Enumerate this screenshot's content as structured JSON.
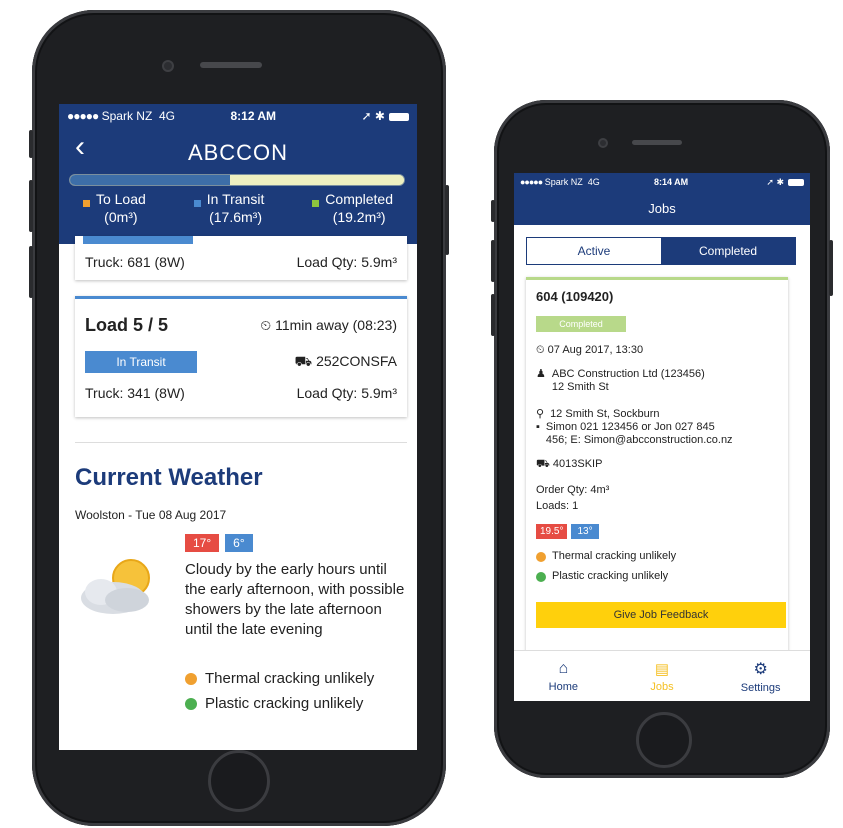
{
  "colors": {
    "brand_blue": "#1c3b7a",
    "to_load": "#f0a030",
    "in_transit": "#4a8ad0",
    "completed": "#8dc63f",
    "temp_high": "#e64c43",
    "temp_low": "#4a8ad0",
    "thermal": "#f0a030",
    "plastic": "#4caf50",
    "feedback": "#ffd00c",
    "jobs_active": "#f5c024"
  },
  "left_phone": {
    "status": {
      "carrier": "Spark NZ",
      "network": "4G",
      "time": "8:12 AM"
    },
    "header": {
      "back_icon": "chevron-left-icon",
      "title": "ABCCON"
    },
    "progress": {
      "to_load": 0,
      "in_transit": 17.6,
      "completed": 19.2
    },
    "legend": [
      {
        "label": "To Load",
        "amount": "(0m³)"
      },
      {
        "label": "In Transit",
        "amount": "(17.6m³)"
      },
      {
        "label": "Completed",
        "amount": "(19.2m³)"
      }
    ],
    "prev_card": {
      "truck": "Truck: 681 (8W)",
      "load_qty": "Load Qty: 5.9m³"
    },
    "load_card": {
      "title": "Load 5 / 5",
      "eta": "11min away (08:23)",
      "status": "In Transit",
      "plant": "252CONSFA",
      "truck": "Truck: 341 (8W)",
      "load_qty": "Load Qty: 5.9m³"
    },
    "weather": {
      "title": "Current Weather",
      "location_date": "Woolston - Tue 08 Aug 2017",
      "high": "17°",
      "low": "6°",
      "description": "Cloudy by the early hours until the early afternoon, with possible showers by the late afternoon until the late evening",
      "thermal": "Thermal cracking unlikely",
      "plastic": "Plastic cracking unlikely"
    }
  },
  "right_phone": {
    "status": {
      "carrier": "Spark NZ",
      "network": "4G",
      "time": "8:14 AM"
    },
    "header": {
      "title": "Jobs"
    },
    "segments": {
      "active": "Active",
      "completed": "Completed"
    },
    "job": {
      "title": "604 (109420)",
      "status": "Completed",
      "datetime": "07 Aug 2017, 13:30",
      "customer": "ABC Construction Ltd (123456)",
      "customer_address": "12 Smith St",
      "site_address": "12 Smith St, Sockburn",
      "contact_line1": "Simon 021 123456 or Jon 027 845",
      "contact_line2": "456; E: Simon@abcconstruction.co.nz",
      "plant": "4013SKIP",
      "order_qty": "Order Qty: 4m³",
      "loads": "Loads: 1",
      "high": "19.5°",
      "low": "13°",
      "thermal": "Thermal cracking unlikely",
      "plastic": "Plastic cracking unlikely",
      "feedback_button": "Give Job Feedback"
    },
    "tabs": [
      {
        "label": "Home",
        "icon": "home-icon"
      },
      {
        "label": "Jobs",
        "icon": "jobs-document-icon"
      },
      {
        "label": "Settings",
        "icon": "settings-gears-icon"
      }
    ]
  }
}
